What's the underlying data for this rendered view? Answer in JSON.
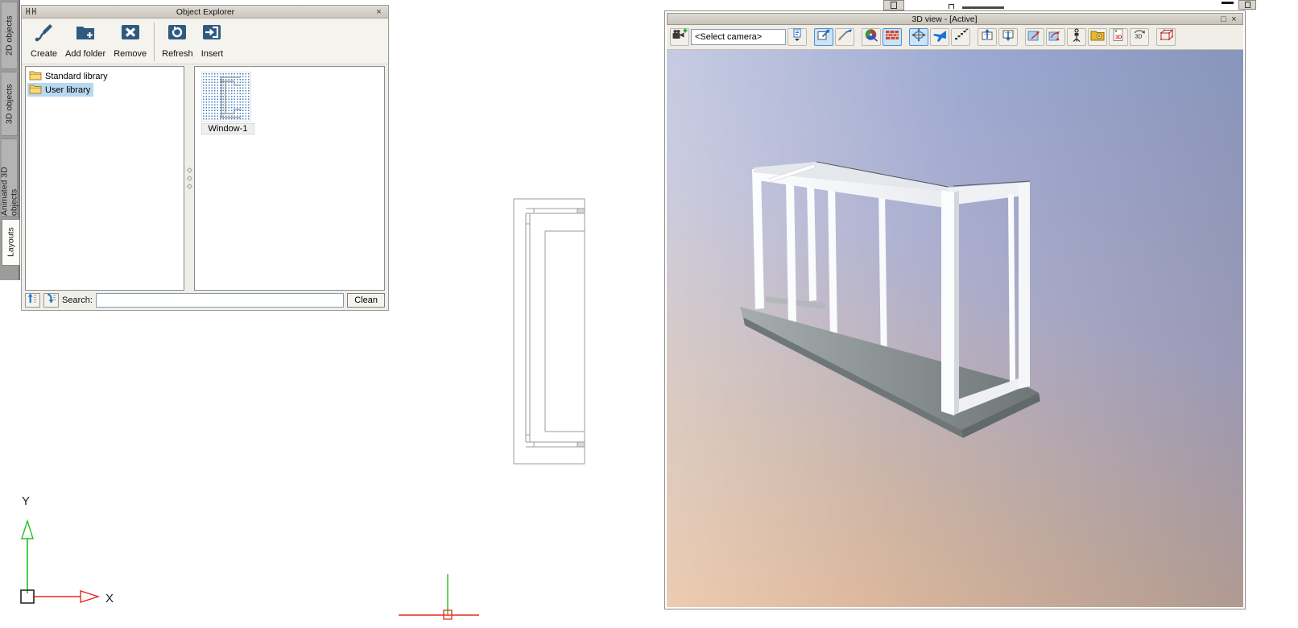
{
  "left_tab_strip": {
    "tabs": [
      {
        "label": "2D objects",
        "active": false
      },
      {
        "label": "3D objects",
        "active": false
      },
      {
        "label": "Animated 3D objects",
        "active": false
      },
      {
        "label": "Layouts",
        "active": true
      }
    ]
  },
  "object_explorer": {
    "title": "Object Explorer",
    "window_controls": {
      "close": "×"
    },
    "toolbar": {
      "buttons": [
        {
          "label": "Create",
          "icon": "create-icon"
        },
        {
          "label": "Add folder",
          "icon": "add-folder-icon"
        },
        {
          "label": "Remove",
          "icon": "remove-icon"
        },
        {
          "label": "Refresh",
          "icon": "refresh-icon"
        },
        {
          "label": "Insert",
          "icon": "insert-icon"
        }
      ]
    },
    "tree": {
      "items": [
        {
          "label": "Standard library",
          "icon": "folder-icon",
          "selected": false
        },
        {
          "label": "User library",
          "icon": "folder-icon",
          "selected": true
        }
      ]
    },
    "library_items": [
      {
        "label": "Window-1"
      }
    ],
    "search": {
      "label": "Search:",
      "value": "",
      "clean_button": "Clean"
    }
  },
  "canvas": {
    "axis_labels": {
      "x": "X",
      "y": "Y"
    },
    "axis_colors": {
      "x": "#e8281e",
      "y": "#21c31f"
    }
  },
  "view3d": {
    "title": "3D view - [Active]",
    "window_controls": {
      "maximize": "□",
      "close": "×"
    },
    "camera_selector": {
      "value": "<Select camera>"
    },
    "icon_glyphs": {
      "export_3d": "3D",
      "rotate_3d": "3D"
    },
    "toolbar_icons": [
      "add-camera-icon",
      "camera-list-dropdown-icon",
      "zoom-window-icon",
      "zoom-distance-icon",
      "color-settings-icon",
      "materials-icon",
      "orbit-icon",
      "fly-mode-icon",
      "walk-mode-icon",
      "zoom-extents-icon",
      "zoom-selected-icon",
      "move-view-icon",
      "rotate-view-icon",
      "camera-position-icon",
      "snapshot-icon",
      "export-3d-icon",
      "rotate-3d-icon",
      "wireframe-grid-icon"
    ],
    "active_buttons": [
      "zoom-window",
      "materials",
      "orbit"
    ],
    "colors": {
      "bg_top_left": "#c6cae4",
      "bg_top_right": "#8da3cf",
      "bg_bottom_left": "#e9bb97",
      "bg_bottom_right": "#a8908c",
      "frame": "#f8f9fb",
      "platform_top": "#969da0",
      "platform_front": "#757c7e"
    }
  }
}
